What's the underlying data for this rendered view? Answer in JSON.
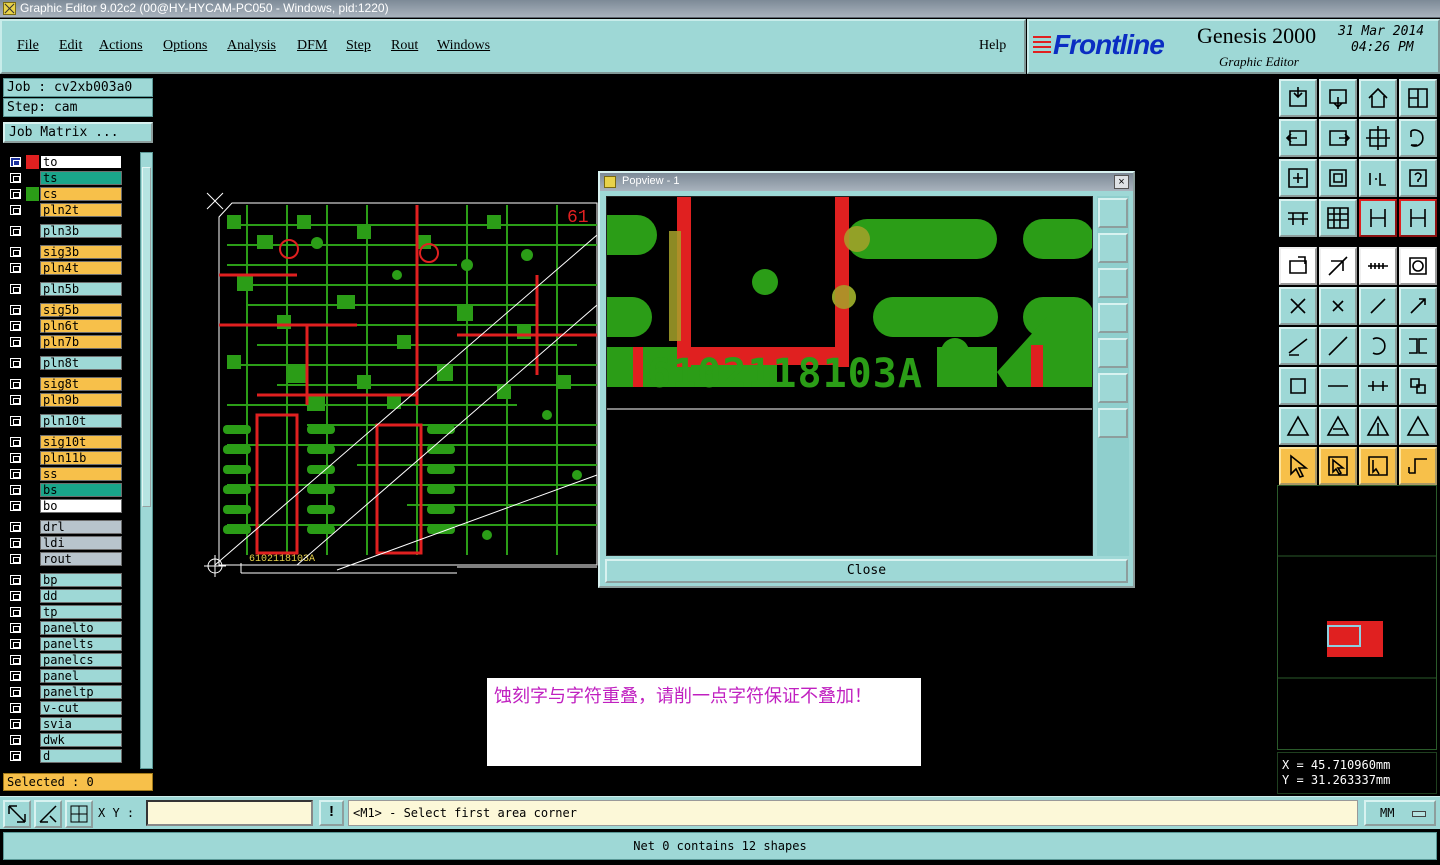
{
  "window": {
    "title": "Graphic Editor 9.02c2 (00@HY-HYCAM-PC050 - Windows, pid:1220)"
  },
  "menubar": {
    "items": [
      "File",
      "Edit",
      "Actions",
      "Options",
      "Analysis",
      "DFM",
      "Step",
      "Rout",
      "Windows"
    ],
    "help": "Help"
  },
  "branding": {
    "brand": "Frontline",
    "product": "Genesis 2000",
    "subtitle": "Graphic Editor",
    "date": "31 Mar 2014",
    "time": "04:26 PM"
  },
  "job": {
    "job_label": "Job : cv2xb003a0",
    "step_label": "Step: cam",
    "matrix_button": "Job Matrix ..."
  },
  "layers": [
    {
      "name": "to",
      "color": "#ffffff",
      "swatch": "#e02020",
      "active": true
    },
    {
      "name": "ts",
      "color": "#1aa58a",
      "swatch": ""
    },
    {
      "name": "cs",
      "color": "#f7c04a",
      "swatch": "#2b9d17"
    },
    {
      "name": "pln2t",
      "color": "#f7c04a",
      "swatch": ""
    },
    {
      "name": "pln3b",
      "color": "#9ed8d6",
      "swatch": ""
    },
    {
      "name": "sig3b",
      "color": "#f7c04a",
      "swatch": ""
    },
    {
      "name": "pln4t",
      "color": "#f7c04a",
      "swatch": ""
    },
    {
      "name": "pln5b",
      "color": "#9ed8d6",
      "swatch": ""
    },
    {
      "name": "sig5b",
      "color": "#f7c04a",
      "swatch": ""
    },
    {
      "name": "pln6t",
      "color": "#f7c04a",
      "swatch": ""
    },
    {
      "name": "pln7b",
      "color": "#f7c04a",
      "swatch": ""
    },
    {
      "name": "pln8t",
      "color": "#9ed8d6",
      "swatch": ""
    },
    {
      "name": "sig8t",
      "color": "#f7c04a",
      "swatch": ""
    },
    {
      "name": "pln9b",
      "color": "#f7c04a",
      "swatch": ""
    },
    {
      "name": "pln10t",
      "color": "#9ed8d6",
      "swatch": ""
    },
    {
      "name": "sig10t",
      "color": "#f7c04a",
      "swatch": ""
    },
    {
      "name": "pln11b",
      "color": "#f7c04a",
      "swatch": ""
    },
    {
      "name": "ss",
      "color": "#f7c04a",
      "swatch": ""
    },
    {
      "name": "bs",
      "color": "#1aa58a",
      "swatch": ""
    },
    {
      "name": "bo",
      "color": "#ffffff",
      "swatch": ""
    },
    {
      "name": "drl",
      "color": "#b8c4cc",
      "swatch": ""
    },
    {
      "name": "ldi",
      "color": "#b8c4cc",
      "swatch": ""
    },
    {
      "name": "rout",
      "color": "#b8c4cc",
      "swatch": ""
    },
    {
      "name": "bp",
      "color": "#9ed8d6",
      "swatch": ""
    },
    {
      "name": "dd",
      "color": "#9ed8d6",
      "swatch": ""
    },
    {
      "name": "tp",
      "color": "#9ed8d6",
      "swatch": ""
    },
    {
      "name": "panelto",
      "color": "#9ed8d6",
      "swatch": ""
    },
    {
      "name": "panelts",
      "color": "#9ed8d6",
      "swatch": ""
    },
    {
      "name": "panelcs",
      "color": "#9ed8d6",
      "swatch": ""
    },
    {
      "name": "panel",
      "color": "#9ed8d6",
      "swatch": ""
    },
    {
      "name": "paneltp",
      "color": "#9ed8d6",
      "swatch": ""
    },
    {
      "name": "v-cut",
      "color": "#9ed8d6",
      "swatch": ""
    },
    {
      "name": "svia",
      "color": "#9ed8d6",
      "swatch": ""
    },
    {
      "name": "dwk",
      "color": "#9ed8d6",
      "swatch": ""
    },
    {
      "name": "d",
      "color": "#9ed8d6",
      "swatch": ""
    }
  ],
  "selected": "Selected : 0",
  "canvas": {
    "board_text": "61",
    "silk_text": "6102118103A"
  },
  "popview": {
    "title": "Popview - 1",
    "close_x": "×",
    "silk_text": "6102118103A",
    "close_label": "Close"
  },
  "note": {
    "text": "蚀刻字与字符重叠，请削一点字符保证不叠加！"
  },
  "coords": {
    "x": "X  = 45.710960mm",
    "y": "Y  = 31.263337mm"
  },
  "command": {
    "xy_label": "X Y :",
    "warn": "!",
    "prompt": "<M1> - Select first area corner",
    "units": "MM"
  },
  "status": {
    "text": "Net 0 contains 12 shapes"
  },
  "toolbar_icons": [
    "step-up-icon",
    "step-down-icon",
    "home-icon",
    "zoom-window-icon",
    "pan-left-icon",
    "pan-right-icon",
    "zoom-in-out-icon",
    "redraw-icon",
    "fit-all-icon",
    "fit-profile-icon",
    "one-to-one-icon",
    "help-query-icon",
    "measure-icon",
    "grid-icon",
    "snap-settings-icon",
    "snap-active-icon",
    "select-pad-icon",
    "select-line-icon",
    "ruler-icon",
    "select-area-icon",
    "connect-nodes-icon",
    "delete-node-icon",
    "add-node-icon",
    "move-node-icon",
    "slant-line-icon",
    "draw-line-icon",
    "rotate-icon",
    "mirror-icon",
    "pad-add-icon",
    "break-line-icon",
    "stretch-icon",
    "clone-icon",
    "triangle-a-icon",
    "triangle-b-icon",
    "triangle-c-icon",
    "triangle-d-icon",
    "pointer-icon",
    "pointer-box-icon",
    "pointer-alt-icon",
    "route-icon"
  ]
}
